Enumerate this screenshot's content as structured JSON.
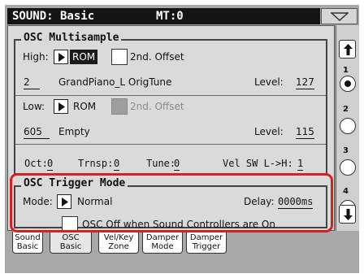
{
  "title": {
    "left": "SOUND: Basic",
    "right": "MT:0"
  },
  "osc_multisample": {
    "group_title": "OSC Multisample",
    "high": {
      "label": "High:",
      "source": "ROM",
      "offset_label": "2nd. Offset",
      "sample_number": "2",
      "sample_name": "GrandPiano_L OrigTune",
      "level_label": "Level:",
      "level": "127"
    },
    "low": {
      "label": "Low:",
      "source": "ROM",
      "offset_label": "2nd. Offset",
      "sample_number": "605",
      "sample_name": "Empty",
      "level_label": "Level:",
      "level": "115"
    },
    "params": {
      "oct_label": "Oct:",
      "oct": "0",
      "trnsp_label": "Trnsp:",
      "trnsp": "0",
      "tune_label": "Tune:",
      "tune": "0",
      "velsw_label": "Vel SW L->H:",
      "velsw": "1"
    }
  },
  "osc_trigger": {
    "group_title": "OSC Trigger Mode",
    "mode_label": "Mode:",
    "mode": "Normal",
    "delay_label": "Delay:",
    "delay": "0000ms",
    "checkbox_label": "OSC Off when Sound Controllers are On"
  },
  "pages": [
    "1",
    "2",
    "3",
    "4"
  ],
  "active_page": "1",
  "tabs": [
    {
      "line1": "Sound",
      "line2": "Basic"
    },
    {
      "line1": "OSC",
      "line2": "Basic"
    },
    {
      "line1": "Vel/Key",
      "line2": "Zone"
    },
    {
      "line1": "Damper",
      "line2": "Mode"
    },
    {
      "line1": "Damper",
      "line2": "Trigger"
    }
  ],
  "colors": {
    "highlight": "#d82020",
    "selected_bg": "#1b1b1b"
  }
}
